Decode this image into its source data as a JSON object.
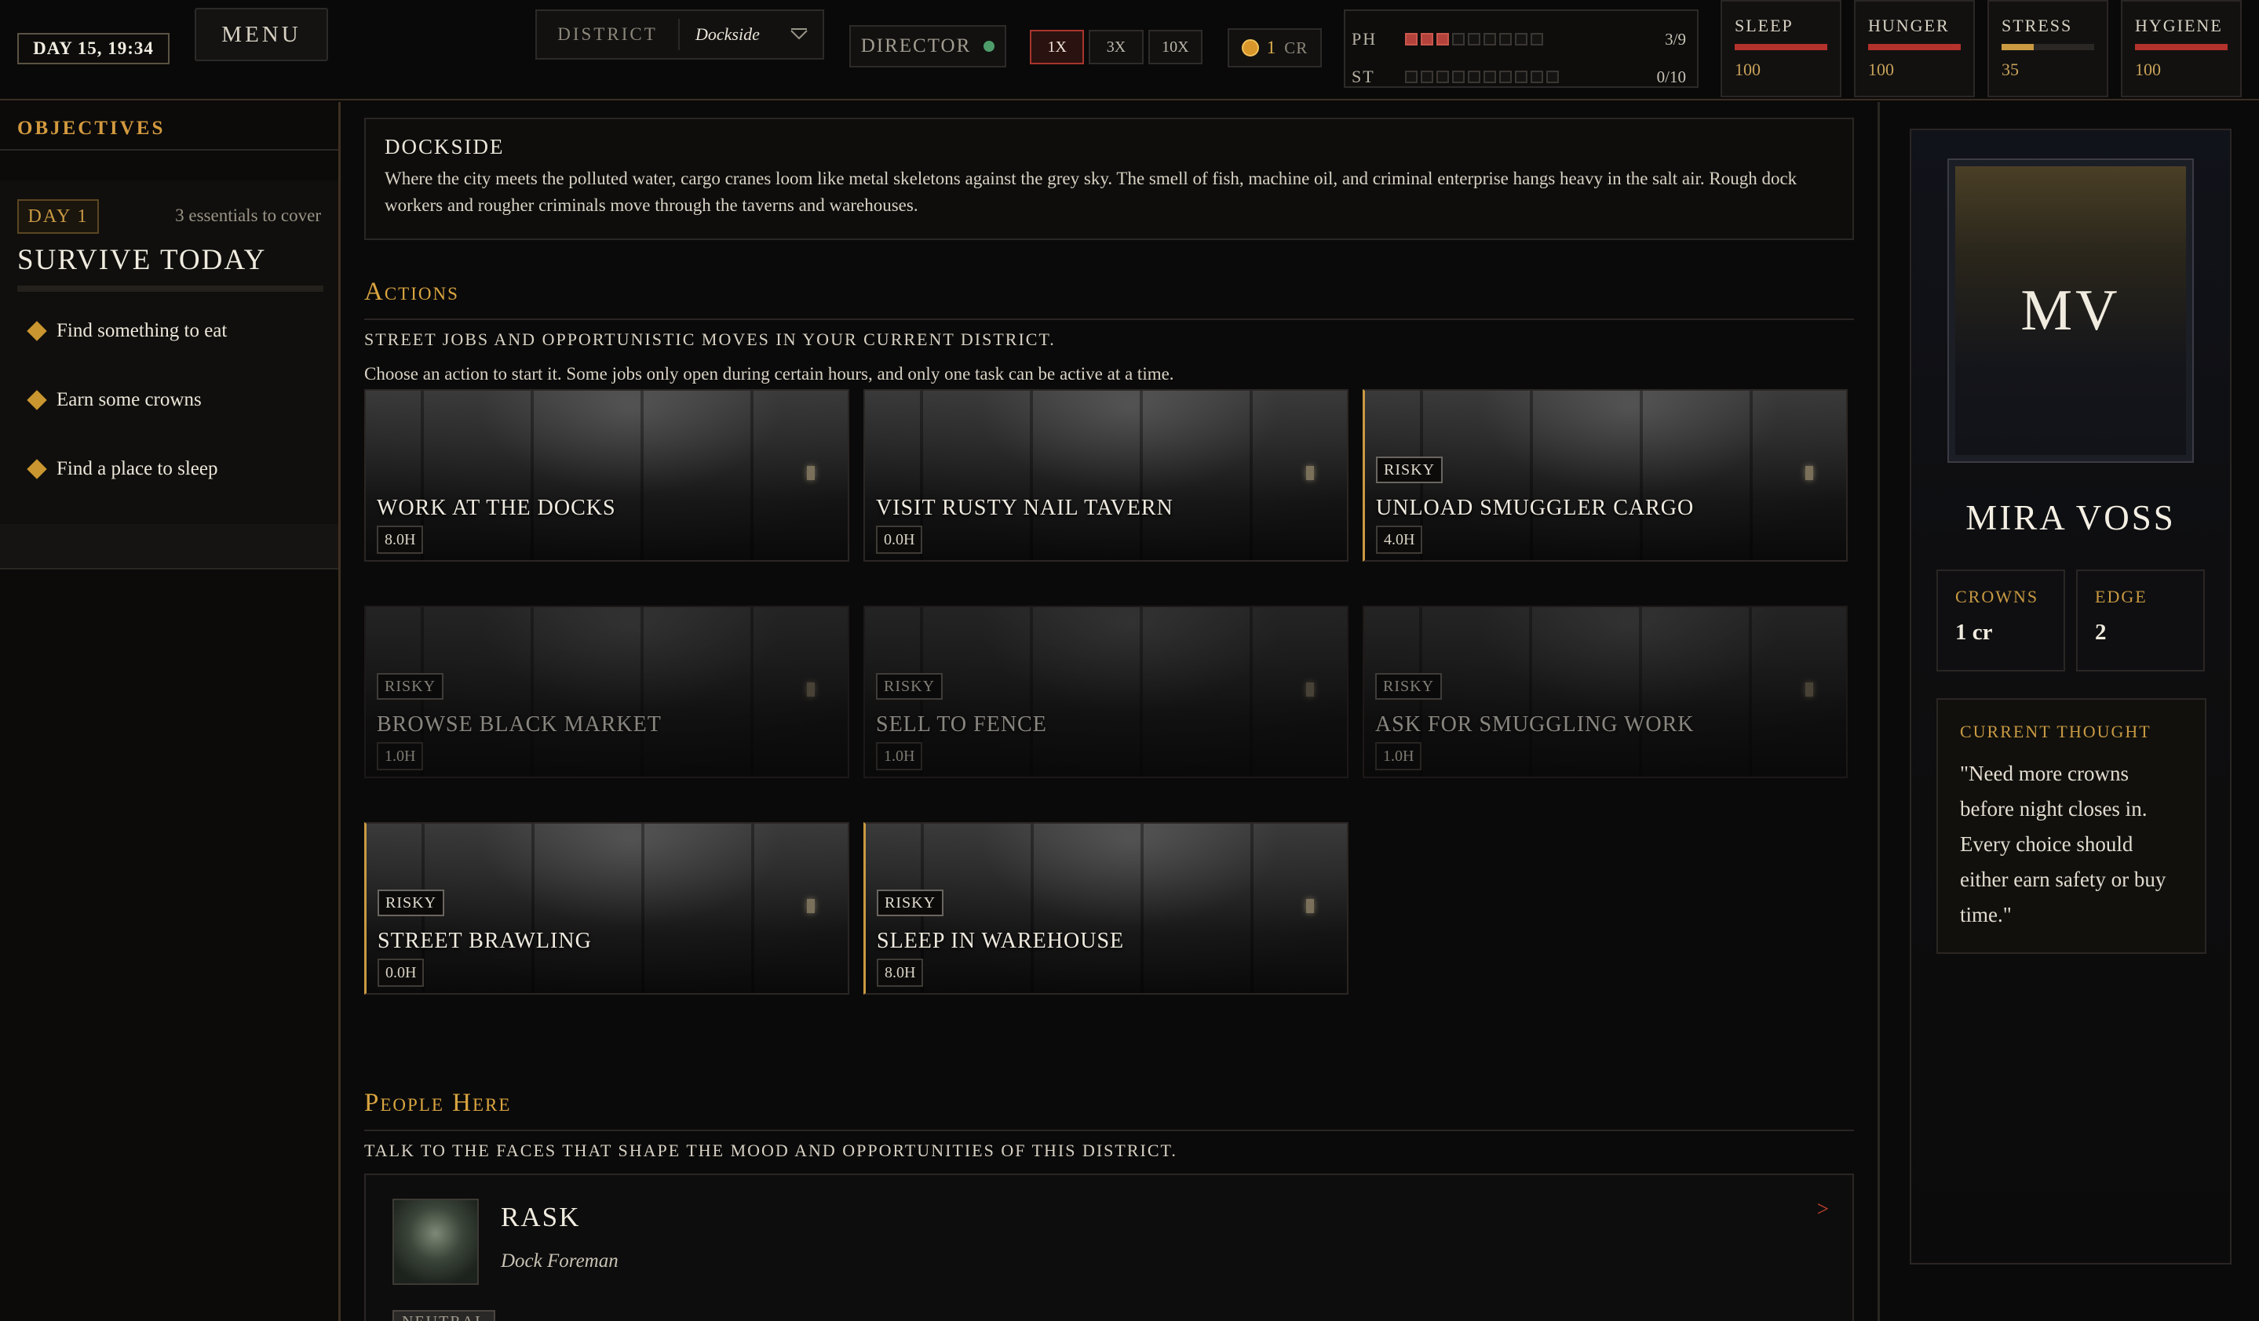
{
  "topbar": {
    "day_time": "DAY 15, 19:34",
    "menu_label": "MENU",
    "district_label": "DISTRICT",
    "district_value": "Dockside",
    "director_label": "DIRECTOR",
    "speeds": [
      "1X",
      "3X",
      "10X"
    ],
    "active_speed": "1X",
    "crowns_value": "1",
    "crowns_unit": "CR",
    "meters": [
      {
        "label": "PH",
        "value": "3/9",
        "filled": 3,
        "total": 9
      },
      {
        "label": "ST",
        "value": "0/10",
        "filled": 0,
        "total": 10
      }
    ],
    "stats": [
      {
        "name": "SLEEP",
        "value": "100",
        "level": 1.0,
        "color": "#b3322c"
      },
      {
        "name": "HUNGER",
        "value": "100",
        "level": 1.0,
        "color": "#b3322c"
      },
      {
        "name": "STRESS",
        "value": "35",
        "level": 0.35,
        "color": "#c99a42"
      },
      {
        "name": "HYGIENE",
        "value": "100",
        "level": 1.0,
        "color": "#b3322c"
      }
    ]
  },
  "objectives": {
    "header": "OBJECTIVES",
    "day_tag": "DAY 1",
    "essentials": "3 essentials to cover",
    "title": "SURVIVE TODAY",
    "items": [
      "Find something to eat",
      "Earn some crowns",
      "Find a place to sleep"
    ]
  },
  "location": {
    "title": "DOCKSIDE",
    "description": "Where the city meets the polluted water, cargo cranes loom like metal skeletons against the grey sky. The smell of fish, machine oil, and criminal enterprise hangs heavy in the salt air. Rough dock workers and rougher criminals move through the taverns and warehouses."
  },
  "actions": {
    "heading": "Actions",
    "subtitle": "Street jobs and opportunistic moves in your current district.",
    "note": "Choose an action to start it. Some jobs only open during certain hours, and only one task can be active at a time.",
    "risky_label": "RISKY",
    "items": [
      {
        "title": "WORK AT THE DOCKS",
        "hours": "8.0H",
        "risky": false,
        "available": true
      },
      {
        "title": "VISIT RUSTY NAIL TAVERN",
        "hours": "0.0H",
        "risky": false,
        "available": true
      },
      {
        "title": "UNLOAD SMUGGLER CARGO",
        "hours": "4.0H",
        "risky": true,
        "available": true
      },
      {
        "title": "BROWSE BLACK MARKET",
        "hours": "1.0H",
        "risky": true,
        "available": false
      },
      {
        "title": "SELL TO FENCE",
        "hours": "1.0H",
        "risky": true,
        "available": false
      },
      {
        "title": "ASK FOR SMUGGLING WORK",
        "hours": "1.0H",
        "risky": true,
        "available": false
      },
      {
        "title": "STREET BRAWLING",
        "hours": "0.0H",
        "risky": true,
        "available": true
      },
      {
        "title": "SLEEP IN WAREHOUSE",
        "hours": "8.0H",
        "risky": true,
        "available": true
      }
    ]
  },
  "people": {
    "heading": "People Here",
    "subtitle": "Talk to the faces that shape the mood and opportunities of this district.",
    "list": [
      {
        "name": "RASK",
        "role": "Dock Foreman",
        "tag": "NEUTRAL",
        "arrow": ">"
      }
    ]
  },
  "character": {
    "initials": "MV",
    "name": "MIRA VOSS",
    "crowns_label": "CROWNS",
    "crowns_value": "1 cr",
    "edge_label": "EDGE",
    "edge_value": "2",
    "thought_label": "CURRENT THOUGHT",
    "thought_text": "\"Need more crowns before night closes in. Every choice should either earn safety or buy time.\""
  }
}
